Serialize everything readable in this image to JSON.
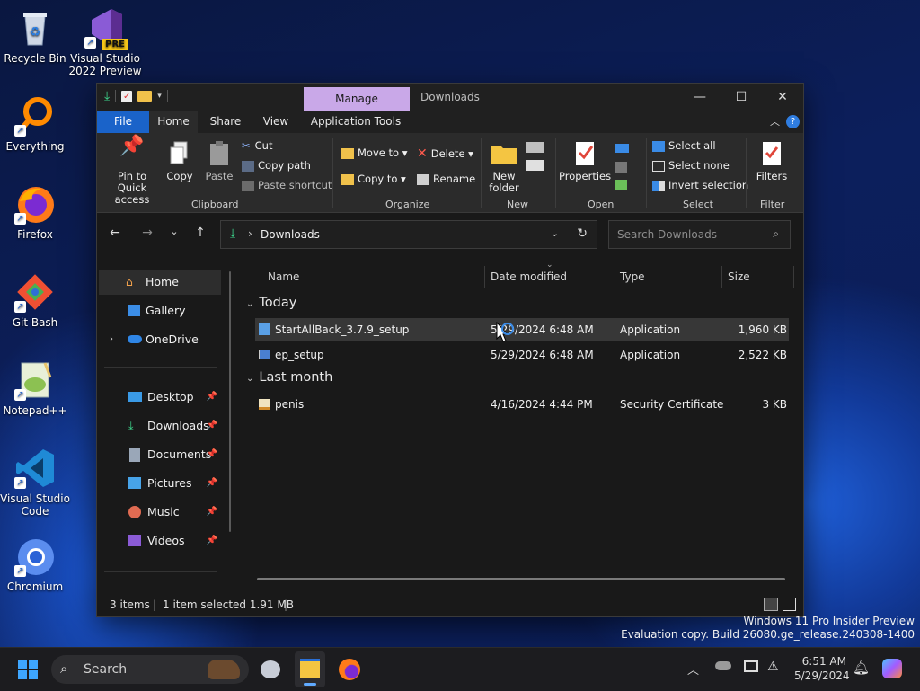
{
  "desktop": {
    "icons": [
      {
        "label": "Recycle Bin",
        "icon": "recycle-bin-icon"
      },
      {
        "label": "Visual Studio 2022 Preview",
        "badge": "PRE",
        "icon": "visual-studio-icon"
      },
      {
        "label": "Everything",
        "icon": "everything-search-icon"
      },
      {
        "label": "Firefox",
        "icon": "firefox-icon"
      },
      {
        "label": "Git Bash",
        "icon": "git-bash-icon"
      },
      {
        "label": "Notepad++",
        "icon": "notepad-plus-plus-icon"
      },
      {
        "label": "Visual Studio Code",
        "icon": "vscode-icon"
      },
      {
        "label": "Chromium",
        "icon": "chromium-icon"
      }
    ],
    "watermark": {
      "line1": "Windows 11 Pro Insider Preview",
      "line2": "Evaluation copy. Build 26080.ge_release.240308-1400"
    }
  },
  "window": {
    "title": "Downloads",
    "contextual_tab": "Manage",
    "tabs": [
      "File",
      "Home",
      "Share",
      "View",
      "Application Tools"
    ],
    "ribbon": {
      "clipboard": {
        "label": "Clipboard",
        "pin": "Pin to Quick access",
        "copy": "Copy",
        "paste": "Paste",
        "cut": "Cut",
        "copy_path": "Copy path",
        "paste_shortcut": "Paste shortcut"
      },
      "organize": {
        "label": "Organize",
        "move_to": "Move to",
        "copy_to": "Copy to",
        "delete": "Delete",
        "rename": "Rename"
      },
      "new": {
        "label": "New",
        "new_folder": "New folder"
      },
      "open": {
        "label": "Open",
        "properties": "Properties"
      },
      "select": {
        "label": "Select",
        "select_all": "Select all",
        "select_none": "Select none",
        "invert": "Invert selection"
      },
      "filter": {
        "label": "Filter",
        "filters": "Filters"
      }
    },
    "address": {
      "path": "Downloads"
    },
    "search": {
      "placeholder": "Search Downloads"
    },
    "nav": {
      "items": [
        {
          "label": "Home",
          "selected": true
        },
        {
          "label": "Gallery"
        },
        {
          "label": "OneDrive"
        },
        {
          "label": "Desktop",
          "pinned": true
        },
        {
          "label": "Downloads",
          "pinned": true
        },
        {
          "label": "Documents",
          "pinned": true
        },
        {
          "label": "Pictures",
          "pinned": true
        },
        {
          "label": "Music",
          "pinned": true
        },
        {
          "label": "Videos",
          "pinned": true
        }
      ]
    },
    "columns": [
      "Name",
      "Date modified",
      "Type",
      "Size"
    ],
    "groups": [
      {
        "label": "Today",
        "files": [
          {
            "name": "StartAllBack_3.7.9_setup",
            "date": "5/29/2024 6:48 AM",
            "type": "Application",
            "size": "1,960 KB",
            "selected": true
          },
          {
            "name": "ep_setup",
            "date": "5/29/2024 6:48 AM",
            "type": "Application",
            "size": "2,522 KB"
          }
        ]
      },
      {
        "label": "Last month",
        "files": [
          {
            "name": "penis",
            "date": "4/16/2024 4:44 PM",
            "type": "Security Certificate",
            "size": "3 KB"
          }
        ]
      }
    ],
    "status": {
      "items": "3 items",
      "selected": "1 item selected  1.91 MB"
    }
  },
  "taskbar": {
    "search_label": "Search",
    "time": "6:51 AM",
    "date": "5/29/2024"
  }
}
